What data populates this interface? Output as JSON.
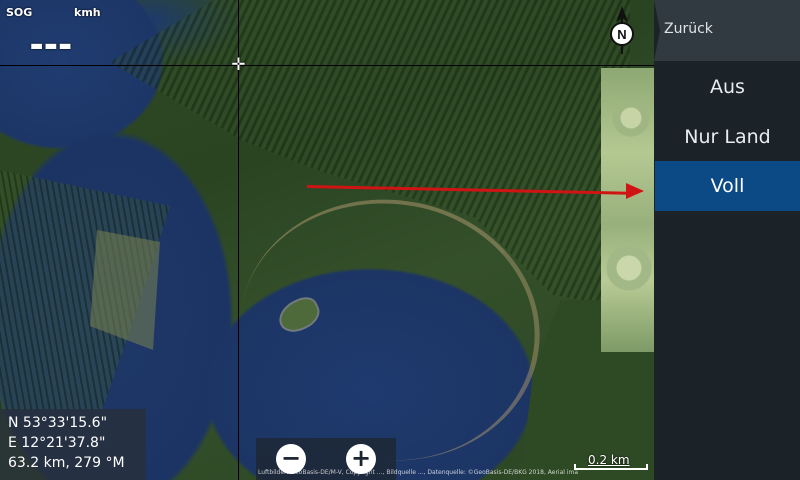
{
  "hud": {
    "sog_label": "SOG",
    "sog_unit": "kmh",
    "sog_value": "▬▬▬"
  },
  "coords": {
    "lat": "N  53°33'15.6\"",
    "lon": "E  12°21'37.8\"",
    "range_bearing": "63.2 km, 279 °M"
  },
  "zoom": {
    "out_label": "−",
    "in_label": "+"
  },
  "compass": {
    "label": "N"
  },
  "scale": {
    "label": "0.2 km"
  },
  "attribution": "Luftbilder: GeoBasis-DE/M-V, Copyright ..., Bildquelle ..., Datenquelle: ©GeoBasis-DE/BKG 2018, Aerial imagery ...",
  "menu": {
    "back_label": "Zurück",
    "items": [
      {
        "label": "Aus",
        "selected": false
      },
      {
        "label": "Nur Land",
        "selected": false
      },
      {
        "label": "Voll",
        "selected": true
      }
    ]
  },
  "colors": {
    "selected_bg": "#0c4a86",
    "panel_bg": "#1c2328",
    "arrow": "#d01414"
  }
}
